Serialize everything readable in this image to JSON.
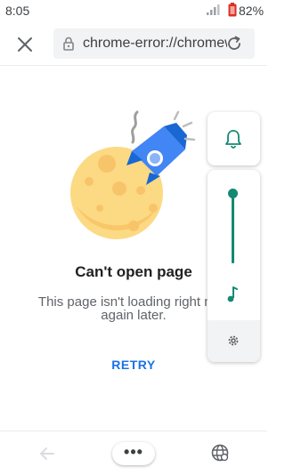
{
  "status_bar": {
    "time": "8:05",
    "battery": "82%",
    "icons": [
      "signal-icon",
      "battery-icon"
    ]
  },
  "toolbar": {
    "url": "chrome-error://chromewebdata/",
    "icons": [
      "close-icon",
      "lock-icon",
      "reload-icon"
    ]
  },
  "error": {
    "title": "Can't open page",
    "message_line1": "This page isn't loading right now. Try",
    "message_line2": "again later.",
    "retry_label": "RETRY",
    "illustration": "moon-rocket-illustration"
  },
  "volume_panel": {
    "icons": [
      "bell-icon",
      "music-note-icon",
      "gear-icon"
    ],
    "media_volume_level": 1.0,
    "accent_color": "#138a72"
  },
  "bottom_bar": {
    "menu_label": "•••",
    "icons": [
      "back-arrow-icon",
      "more-menu-icon",
      "globe-icon"
    ]
  },
  "colors": {
    "link": "#1a73e8",
    "moon": "#fcd983",
    "rocket": "#4285f4"
  }
}
